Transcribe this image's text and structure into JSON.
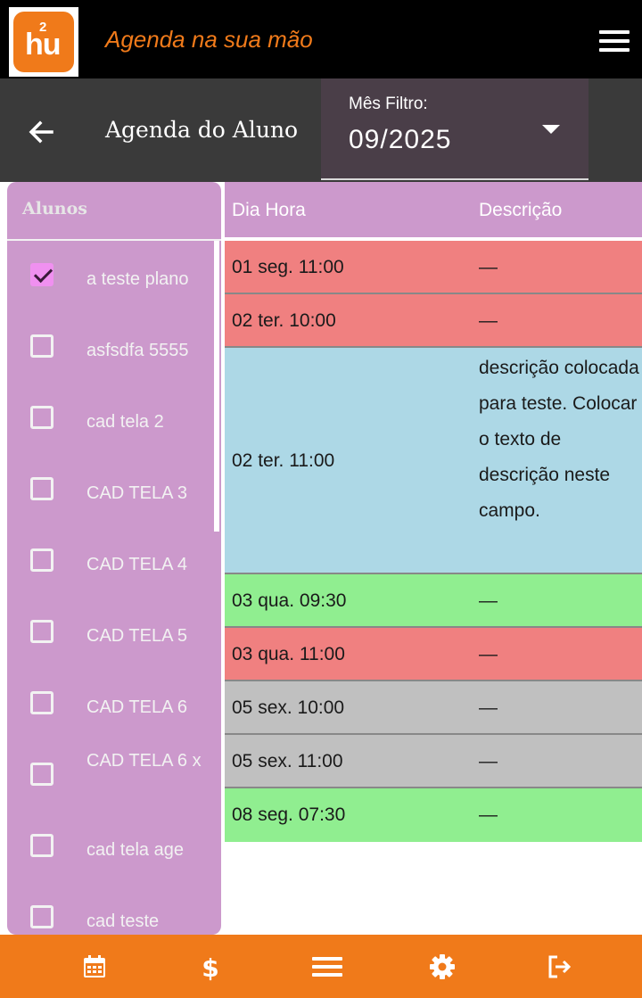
{
  "app": {
    "logo_sup": "2",
    "logo_text": "hu",
    "title": "Agenda na sua mão"
  },
  "header": {
    "title": "Agenda do Aluno",
    "month_label": "Mês Filtro:",
    "month_value": "09/2025"
  },
  "students": {
    "header": "Alunos",
    "items": [
      {
        "name": "a teste plano",
        "checked": true
      },
      {
        "name": "asfsdfa 5555",
        "checked": false
      },
      {
        "name": "cad tela 2",
        "checked": false
      },
      {
        "name": "CAD TELA 3",
        "checked": false
      },
      {
        "name": "CAD TELA 4",
        "checked": false
      },
      {
        "name": "CAD TELA 5",
        "checked": false
      },
      {
        "name": "CAD TELA 6",
        "checked": false
      },
      {
        "name": "CAD TELA 6 x",
        "checked": false
      },
      {
        "name": "cad tela age",
        "checked": false
      },
      {
        "name": "cad teste",
        "checked": false
      }
    ]
  },
  "agenda": {
    "columns": [
      "Dia Hora",
      "Descrição"
    ],
    "rows": [
      {
        "datetime": "01 seg. 11:00",
        "description": "—",
        "status_color": "#f08080"
      },
      {
        "datetime": "02 ter. 10:00",
        "description": "—",
        "status_color": "#f08080"
      },
      {
        "datetime": "02 ter. 11:00",
        "description": "descrição colocada para teste. Colocar o texto de descrição neste campo.",
        "status_color": "#add8e6"
      },
      {
        "datetime": "03 qua. 09:30",
        "description": "—",
        "status_color": "#90ee90"
      },
      {
        "datetime": "03 qua. 11:00",
        "description": "—",
        "status_color": "#f08080"
      },
      {
        "datetime": "05 sex. 10:00",
        "description": "—",
        "status_color": "#c0c0c0"
      },
      {
        "datetime": "05 sex. 11:00",
        "description": "—",
        "status_color": "#c0c0c0"
      },
      {
        "datetime": "08 seg. 07:30",
        "description": "—",
        "status_color": "#90ee90"
      }
    ]
  },
  "bottom_nav": [
    {
      "icon": "calendar-icon"
    },
    {
      "icon": "dollar-icon"
    },
    {
      "icon": "menu-icon"
    },
    {
      "icon": "gear-icon"
    },
    {
      "icon": "logout-icon"
    }
  ],
  "colors": {
    "accent": "#f07a1a",
    "panel": "#cc99cc",
    "subheader": "#3a3a3a"
  }
}
